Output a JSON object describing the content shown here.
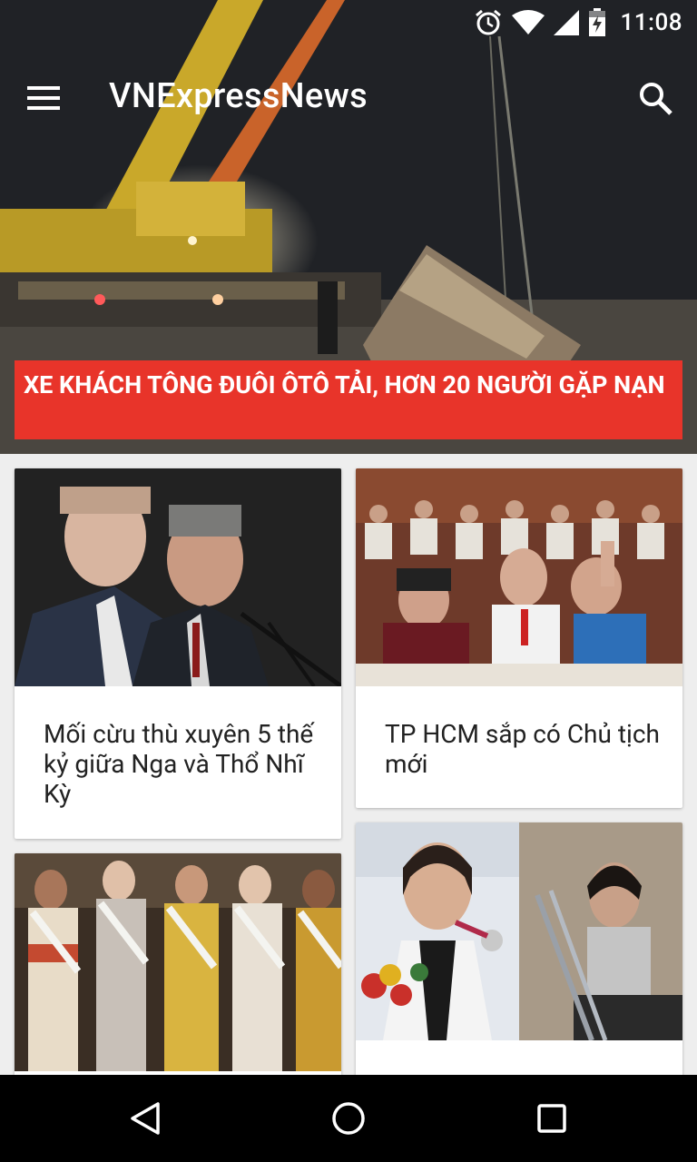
{
  "status_bar": {
    "time": "11:08",
    "icons": [
      "alarm-icon",
      "wifi-icon",
      "cell-signal-icon",
      "battery-icon"
    ]
  },
  "app_bar": {
    "title": "VNExpressNews",
    "icons": [
      "menu-icon",
      "search-icon"
    ]
  },
  "hero": {
    "headline": "XE KHÁCH TÔNG ĐUÔI ÔTÔ TẢI, HƠN 20 NGƯỜI GẶP NẠN",
    "headline_bg": "#e8342a"
  },
  "articles": [
    {
      "title": "Mối cừu thù xuyên 5 thế kỷ giữa Nga và Thổ Nhĩ Kỳ"
    },
    {
      "title": "TP HCM sắp có Chủ tịch mới"
    },
    {
      "title": ""
    },
    {
      "title": ""
    }
  ],
  "nav_bar": {
    "icons": [
      "back-icon",
      "home-icon",
      "recents-icon"
    ]
  }
}
